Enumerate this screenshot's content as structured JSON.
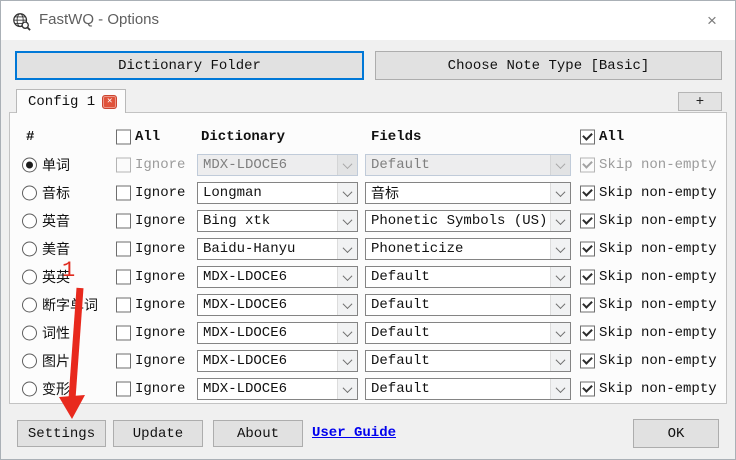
{
  "window": {
    "title": "FastWQ - Options"
  },
  "icons": {
    "close": "×",
    "tab_close": "✕",
    "plus": "+"
  },
  "toolbar": {
    "dictionary_folder": "Dictionary Folder",
    "choose_note_type": "Choose Note Type [Basic]"
  },
  "tabs": {
    "active": "Config 1"
  },
  "table": {
    "headers": {
      "number": "#",
      "all_left": "All",
      "dictionary": "Dictionary",
      "fields": "Fields",
      "all_right": "All"
    },
    "ignore_label": "Ignore",
    "skip_label": "Skip non-empty",
    "rows": [
      {
        "label": "单词",
        "dictionary": "MDX-LDOCE6",
        "fields": "Default",
        "selected": true,
        "enabled": false,
        "skip_checked": true
      },
      {
        "label": "音标",
        "dictionary": "Longman",
        "fields": "音标",
        "selected": false,
        "enabled": true,
        "skip_checked": true
      },
      {
        "label": "英音",
        "dictionary": "Bing xtk",
        "fields": "Phonetic Symbols (US)",
        "selected": false,
        "enabled": true,
        "skip_checked": true
      },
      {
        "label": "美音",
        "dictionary": "Baidu-Hanyu",
        "fields": "Phoneticize",
        "selected": false,
        "enabled": true,
        "skip_checked": true
      },
      {
        "label": "英英",
        "dictionary": "MDX-LDOCE6",
        "fields": "Default",
        "selected": false,
        "enabled": true,
        "skip_checked": true
      },
      {
        "label": "断字单词",
        "dictionary": "MDX-LDOCE6",
        "fields": "Default",
        "selected": false,
        "enabled": true,
        "skip_checked": true
      },
      {
        "label": "词性",
        "dictionary": "MDX-LDOCE6",
        "fields": "Default",
        "selected": false,
        "enabled": true,
        "skip_checked": true
      },
      {
        "label": "图片",
        "dictionary": "MDX-LDOCE6",
        "fields": "Default",
        "selected": false,
        "enabled": true,
        "skip_checked": true
      },
      {
        "label": "变形",
        "dictionary": "MDX-LDOCE6",
        "fields": "Default",
        "selected": false,
        "enabled": true,
        "skip_checked": true
      }
    ]
  },
  "footer": {
    "settings": "Settings",
    "update": "Update",
    "about": "About",
    "user_guide": "User Guide",
    "ok": "OK"
  },
  "annotation": {
    "number": "1"
  },
  "colors": {
    "accent_blue": "#0078d7",
    "tab_close_red": "#e0523a",
    "link_blue": "#0000ee",
    "annotation_red": "#e02a1e",
    "window_bg": "#f0f0f0",
    "button_bg": "#e1e1e1"
  }
}
